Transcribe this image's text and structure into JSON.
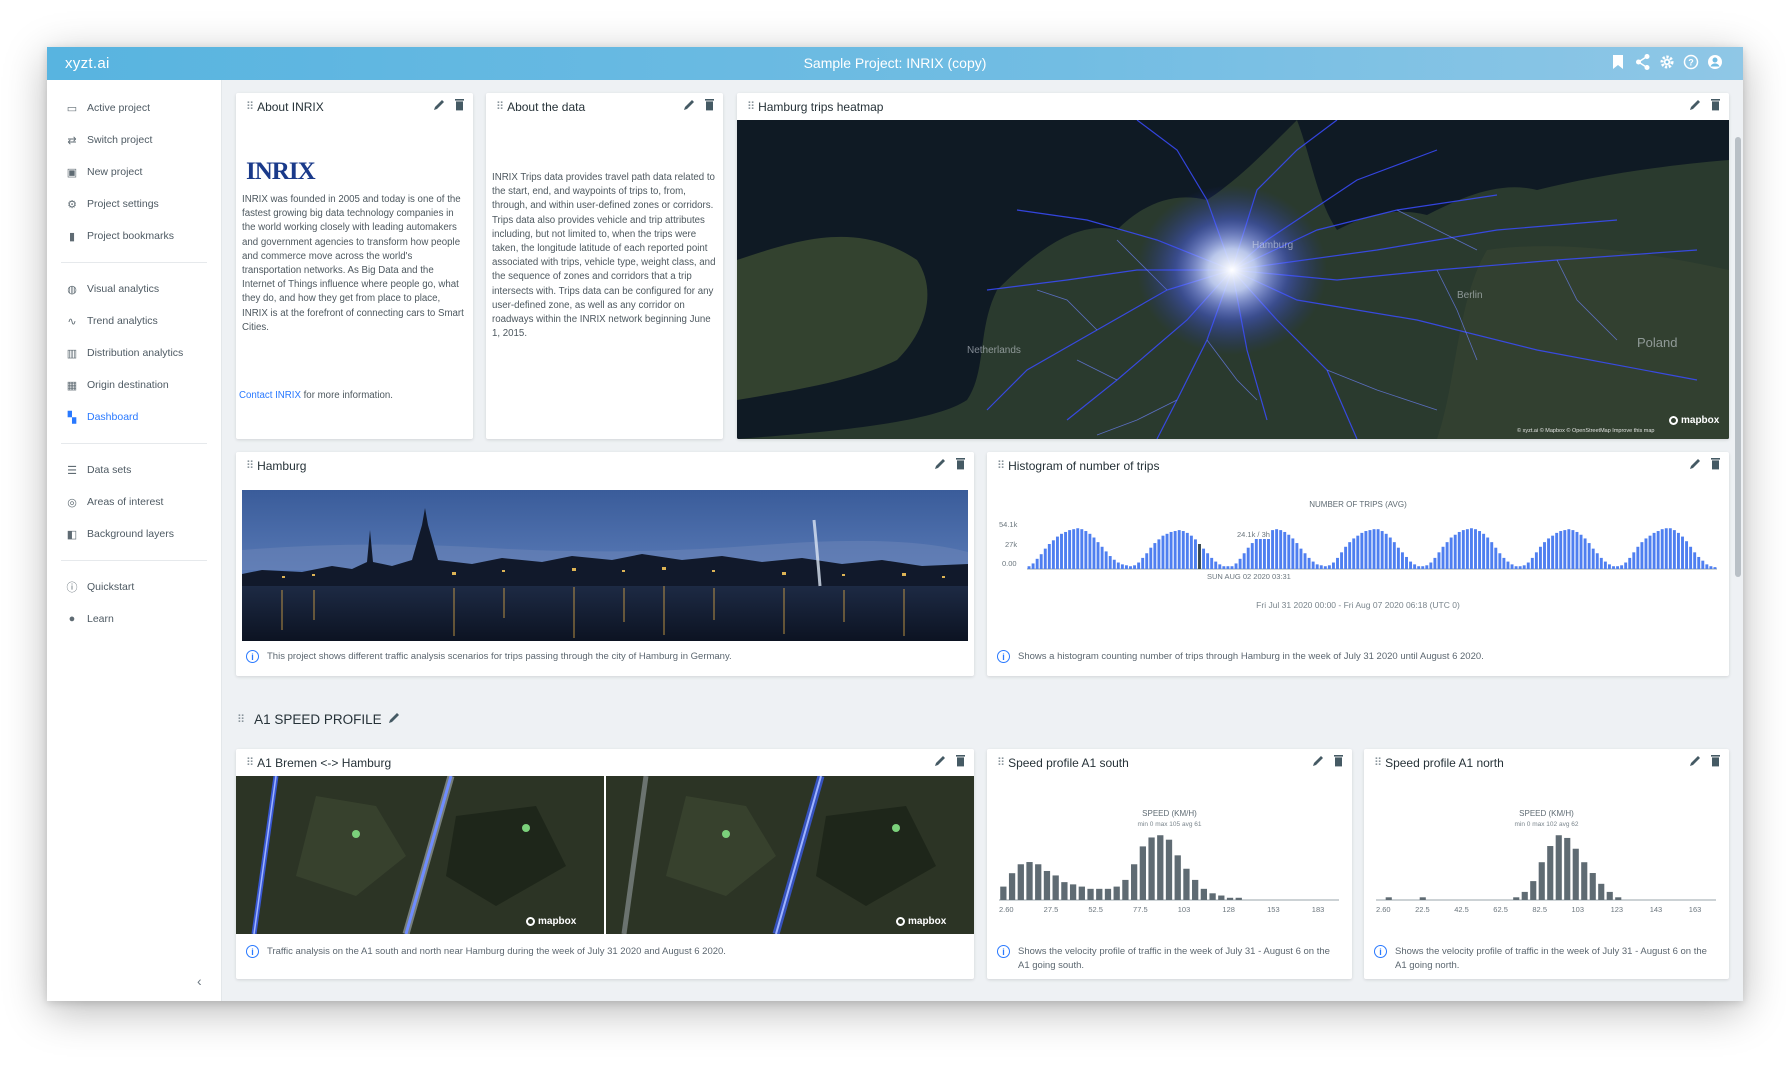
{
  "app": {
    "name": "xyzt.ai",
    "project_title": "Sample Project: INRIX (copy)"
  },
  "topbar_icons": [
    "bookmark-icon",
    "share-icon",
    "gear-icon",
    "help-icon",
    "account-icon"
  ],
  "sidebar": {
    "groups": [
      [
        {
          "label": "Active project",
          "icon": "folder-icon"
        },
        {
          "label": "Switch project",
          "icon": "switch-icon"
        },
        {
          "label": "New project",
          "icon": "new-folder-icon"
        },
        {
          "label": "Project settings",
          "icon": "gear-icon"
        },
        {
          "label": "Project bookmarks",
          "icon": "bookmarks-icon"
        }
      ],
      [
        {
          "label": "Visual analytics",
          "icon": "globe-icon"
        },
        {
          "label": "Trend analytics",
          "icon": "trend-icon"
        },
        {
          "label": "Distribution analytics",
          "icon": "bar-chart-icon"
        },
        {
          "label": "Origin destination",
          "icon": "grid-icon"
        },
        {
          "label": "Dashboard",
          "icon": "dashboard-icon",
          "active": true
        }
      ],
      [
        {
          "label": "Data sets",
          "icon": "list-icon"
        },
        {
          "label": "Areas of interest",
          "icon": "area-icon"
        },
        {
          "label": "Background layers",
          "icon": "layers-icon"
        }
      ],
      [
        {
          "label": "Quickstart",
          "icon": "info-icon"
        },
        {
          "label": "Learn",
          "icon": "bulb-icon"
        }
      ]
    ],
    "collapse": "‹"
  },
  "cards": {
    "about_inrix": {
      "title": "About INRIX",
      "logo": "INRIX",
      "text": "INRIX was founded in 2005 and today is one of the fastest growing big data technology companies in the world working closely with leading automakers and government agencies to transform how people and commerce move across the world's transportation networks. As Big Data and the Internet of Things influence where people go, what they do, and how they get from place to place, INRIX is at the forefront of connecting cars to Smart Cities.",
      "link": "Contact INRIX",
      "link_suffix": " for more information."
    },
    "about_data": {
      "title": "About the data",
      "text": "INRIX Trips data provides travel path data related to the start, end, and waypoints of trips to, from, through, and within user-defined zones or corridors. Trips data also provides vehicle and trip attributes including, but not limited to, when the trips were taken, the longitude latitude of each reported point associated with trips, vehicle type, weight class, and the sequence of zones and corridors that a trip intersects with. Trips data can be configured for any user-defined zone, as well as any corridor on roadways within the INRIX network beginning June 1, 2015."
    },
    "heatmap": {
      "title": "Hamburg trips heatmap",
      "labels": [
        "Poland",
        "Netherlands",
        "Hamburg",
        "Berlin"
      ],
      "mapbox": "mapbox",
      "attribution": "© xyzt.ai © Mapbox © OpenStreetMap Improve this map"
    },
    "hamburg": {
      "title": "Hamburg",
      "caption": "This project shows different traffic analysis scenarios for trips passing through the city of Hamburg in Germany."
    },
    "histogram": {
      "title": "Histogram of number of trips",
      "caption": "Shows a histogram counting number of trips through Hamburg in the week of July 31 2020 until August 6 2020."
    },
    "a1": {
      "title": "A1 Bremen <-> Hamburg",
      "caption": "Traffic analysis on the A1 south and north near Hamburg during the week of July 31 2020 and August 6 2020.",
      "mapbox": "mapbox"
    },
    "speed_south": {
      "title": "Speed profile A1 south",
      "caption": "Shows the velocity profile of traffic in the week of July 31 - August 6 on the A1 going south."
    },
    "speed_north": {
      "title": "Speed profile A1 north",
      "caption": "Shows the velocity profile of traffic in the week of July 31 - August 6 on the A1 going north."
    }
  },
  "section": {
    "title": "A1 SPEED PROFILE"
  },
  "chart_data": [
    {
      "type": "bar",
      "title": "NUMBER OF TRIPS (AVG)",
      "ytick_labels": [
        "54.1k",
        "27k",
        "0.00"
      ],
      "ylim": [
        0,
        54100
      ],
      "annotation": "24.1k / 3h",
      "annotation_x": "SUN AUG 02 2020 03:31",
      "xlabel": "Fri Jul 31 2020 00:00 - Fri Aug 07 2020 06:18 (UTC 0)",
      "values": [
        3,
        6,
        11,
        16,
        22,
        27,
        31,
        35,
        38,
        40,
        42,
        43,
        44,
        43,
        41,
        38,
        34,
        29,
        24,
        19,
        14,
        10,
        7,
        5,
        4,
        3,
        4,
        7,
        12,
        17,
        23,
        28,
        32,
        36,
        38,
        40,
        41,
        42,
        41,
        39,
        36,
        32,
        27,
        22,
        17,
        12,
        8,
        5,
        3,
        3,
        3,
        6,
        11,
        17,
        23,
        28,
        33,
        36,
        39,
        41,
        42,
        43,
        42,
        40,
        37,
        33,
        28,
        22,
        17,
        12,
        8,
        5,
        4,
        3,
        4,
        7,
        12,
        18,
        24,
        29,
        33,
        36,
        39,
        41,
        42,
        43,
        43,
        41,
        38,
        34,
        29,
        23,
        18,
        13,
        8,
        5,
        3,
        3,
        4,
        7,
        12,
        18,
        24,
        29,
        34,
        37,
        40,
        42,
        43,
        44,
        43,
        41,
        38,
        34,
        29,
        23,
        17,
        12,
        8,
        5,
        3,
        3,
        4,
        7,
        12,
        18,
        24,
        29,
        33,
        36,
        39,
        41,
        42,
        43,
        42,
        40,
        37,
        33,
        28,
        22,
        17,
        12,
        8,
        5,
        3,
        3,
        4,
        7,
        12,
        18,
        24,
        29,
        33,
        36,
        39,
        41,
        43,
        44,
        44,
        42,
        39,
        35,
        30,
        24,
        18,
        13,
        9,
        5,
        3,
        2
      ]
    },
    {
      "type": "bar",
      "title": "SPEED (KM/H)",
      "subtitle": "min 0 max 105 avg 61",
      "categories": [
        "2.60",
        "27.5",
        "52.5",
        "77.5",
        "103",
        "128",
        "153",
        "183"
      ],
      "values": [
        6,
        12,
        16,
        17,
        16,
        13,
        11,
        8,
        7,
        6,
        5,
        5,
        5,
        6,
        9,
        16,
        24,
        28,
        29,
        27,
        20,
        14,
        9,
        5,
        3,
        2,
        1,
        1,
        0,
        0,
        0,
        0,
        0,
        0,
        0,
        0,
        0,
        0,
        0
      ]
    },
    {
      "type": "bar",
      "title": "SPEED (KM/H)",
      "subtitle": "min 0 max 102 avg 62",
      "categories": [
        "2.60",
        "22.5",
        "42.5",
        "62.5",
        "82.5",
        "103",
        "123",
        "143",
        "163"
      ],
      "values": [
        0,
        1,
        0,
        0,
        0,
        1,
        0,
        0,
        0,
        0,
        0,
        0,
        0,
        0,
        0,
        0,
        1,
        3,
        7,
        14,
        20,
        24,
        23,
        19,
        14,
        10,
        6,
        3,
        1,
        0,
        0,
        0,
        0,
        0,
        0,
        0,
        0,
        0,
        0,
        0
      ]
    }
  ]
}
